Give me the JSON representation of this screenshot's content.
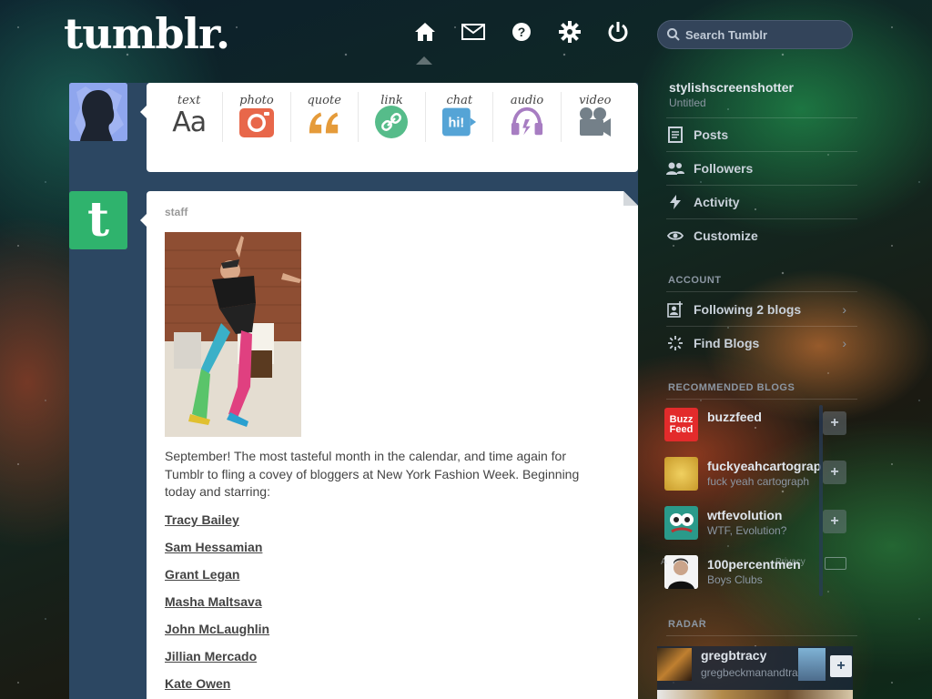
{
  "header": {
    "logo": "tumblr.",
    "search_placeholder": "Search Tumblr"
  },
  "nav": [
    {
      "name": "home-icon"
    },
    {
      "name": "inbox-icon"
    },
    {
      "name": "help-icon"
    },
    {
      "name": "settings-icon"
    },
    {
      "name": "logout-icon"
    }
  ],
  "post_types": [
    {
      "label": "text",
      "icon": "text-icon",
      "color": "#444444"
    },
    {
      "label": "photo",
      "icon": "photo-icon",
      "color": "#e8674a"
    },
    {
      "label": "quote",
      "icon": "quote-icon",
      "color": "#e59b3a"
    },
    {
      "label": "link",
      "icon": "link-icon",
      "color": "#56bc8a"
    },
    {
      "label": "chat",
      "icon": "chat-icon",
      "color": "#55a4d6"
    },
    {
      "label": "audio",
      "icon": "audio-icon",
      "color": "#a77dc2"
    },
    {
      "label": "video",
      "icon": "video-icon",
      "color": "#748089"
    }
  ],
  "post": {
    "author": "staff",
    "body": "September! The most tasteful month in the calendar, and time again for Tumblr to fling a covey of bloggers at New York Fashion Week. Beginning today and starring:",
    "links": [
      "Tracy Bailey",
      "Sam Hessamian",
      "Grant Legan",
      "Masha Maltsava",
      "John McLaughlin",
      "Jillian Mercado",
      "Kate Owen"
    ]
  },
  "sidebar": {
    "blog_name": "stylishscreenshotter",
    "blog_title": "Untitled",
    "menu": [
      {
        "label": "Posts",
        "icon": "posts-icon"
      },
      {
        "label": "Followers",
        "icon": "followers-icon"
      },
      {
        "label": "Activity",
        "icon": "activity-icon"
      },
      {
        "label": "Customize",
        "icon": "customize-icon"
      }
    ],
    "account_heading": "ACCOUNT",
    "account": [
      {
        "label": "Following 2 blogs",
        "icon": "following-icon"
      },
      {
        "label": "Find Blogs",
        "icon": "find-blogs-icon"
      }
    ],
    "recommended_heading": "RECOMMENDED BLOGS",
    "recommended": [
      {
        "name": "buzzfeed",
        "sub": "",
        "thumb_text": "Buzz Feed",
        "color": "#e32b2b"
      },
      {
        "name": "fuckyeahcartograp",
        "sub": "fuck yeah cartograph",
        "color": "#d4a233"
      },
      {
        "name": "wtfevolution",
        "sub": "WTF, Evolution?",
        "color": "#2a9a8a"
      },
      {
        "name": "100percentmen",
        "sub": "Boys Clubs",
        "color": "#f0f0f0"
      }
    ],
    "footer_left": "A",
    "footer_right": "Privacy",
    "radar_heading": "RADAR",
    "radar": {
      "name": "gregbtracy",
      "sub": "gregbeckmanandtracy"
    }
  }
}
